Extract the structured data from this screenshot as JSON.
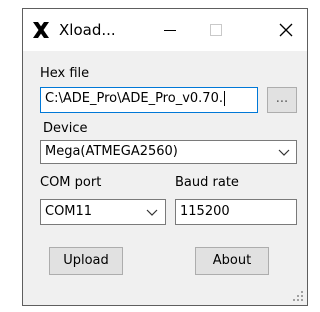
{
  "window": {
    "title": "Xload...",
    "buttons": [
      "minimize",
      "maximize",
      "close"
    ]
  },
  "hex_file": {
    "label": "Hex file",
    "value": "C:\\ADE_Pro\\ADE_Pro_v0.70.",
    "browse_label": "..."
  },
  "device": {
    "label": "Device",
    "selected": "Mega(ATMEGA2560)"
  },
  "com_port": {
    "label": "COM port",
    "selected": "COM11"
  },
  "baud_rate": {
    "label": "Baud rate",
    "value": "115200"
  },
  "actions": {
    "upload_label": "Upload",
    "about_label": "About"
  },
  "icons": {
    "app": "x-logo-icon",
    "minimize": "minimize-icon",
    "maximize": "maximize-icon",
    "close": "close-icon",
    "dropdown": "chevron-down-icon",
    "resize": "resize-grip-icon"
  },
  "colors": {
    "focus_border": "#0078d7",
    "window_bg": "#f0f0f0",
    "button_bg": "#e1e1e1"
  }
}
